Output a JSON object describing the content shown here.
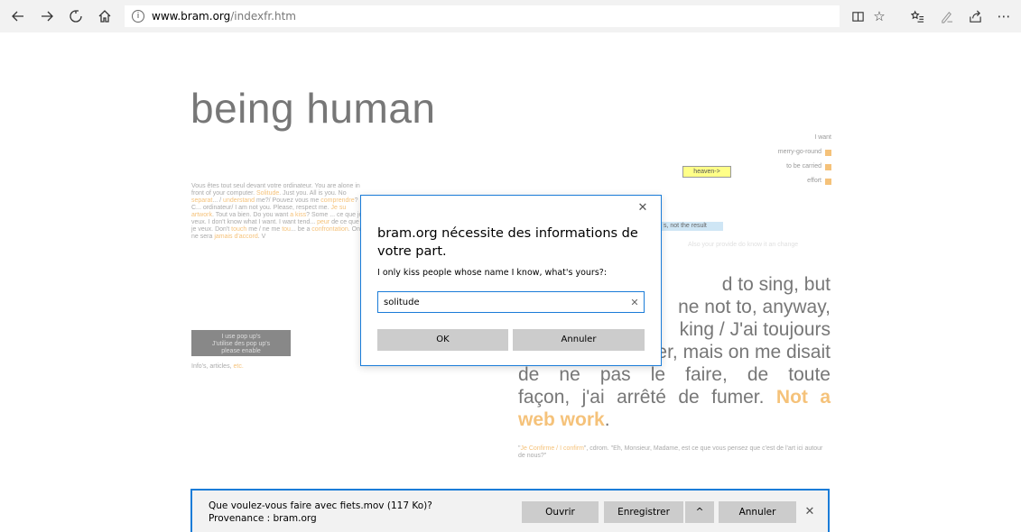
{
  "browser": {
    "url_domain": "www.bram.org",
    "url_path": "/indexfr.htm",
    "info_icon_text": "i",
    "icons": [
      "back-icon",
      "forward-icon",
      "refresh-icon",
      "home-icon",
      "reading-view-icon",
      "favorite-star-icon",
      "favorites-hub-icon",
      "web-note-icon",
      "share-icon",
      "more-icon"
    ]
  },
  "page": {
    "title": "being human",
    "menu_right": {
      "item1": "I want",
      "item2": "merry-go-round",
      "item3": "to be carried",
      "item4": "effort"
    },
    "heaven_label": "heaven->",
    "intro": {
      "p1": "Vous êtes tout seul devant votre ordinateur. You are alone in front of your computer.",
      "link1": "Solitude",
      "p2": ". Just you. All is you. No",
      "link2": "separat",
      "p3": "... /",
      "link3": "understand",
      "p4": "me?/ Pouvez vous me",
      "link4": "comprendre",
      "p5": "? C... ordinateur/ I am not you. Please, respect me.",
      "link5": "Je su",
      "link6": "artwork",
      "p6": ". Tout va bien. Do you want",
      "link7": "a kiss",
      "p7": "? Some ... ce que je veux. I don't know what I want. I want tend...",
      "link8": "peur",
      "p8": "de ce que je veux. Don't",
      "link9": "touch",
      "p9": "me / ne me",
      "link10": "tou",
      "p10": "... be a",
      "link11": "confrontation",
      "p11": ". On ne sera",
      "link12": "jamais d'accord",
      "p12": ". V"
    },
    "highlight_text": "s, not the result",
    "faint_note": "Also your provide do know it an change",
    "popup_button": {
      "line1": "I use pop up's",
      "line2": "J'utilise des pop up's",
      "line3": "please enable"
    },
    "infos": {
      "text": "Info's, articles,",
      "link": "etc."
    },
    "big_text": {
      "l1_visible": "d to sing, but",
      "l2_visible": "ne not to, anyway,",
      "l3_visible": "king / J'ai toujours",
      "l4_visible": "voulu chanter, mais on me disait",
      "l5": "de ne pas le faire, de toute",
      "l6": "façon, j'ai arrêté de fumer.",
      "link": "Not a web work",
      "end": "."
    },
    "foot_note": {
      "quote_open": "\"",
      "link": "Je Confirme / I confirm",
      "rest": "\", cdrom. \"Eh, Monsieur, Madame, est ce que vous pensez que c'est de l'art ici autour de nous?\""
    }
  },
  "dialog": {
    "title": "bram.org nécessite des informations de votre part.",
    "message": "I only kiss people whose name I know, what's yours?:",
    "input_value": "solitude",
    "ok_label": "OK",
    "cancel_label": "Annuler",
    "close_glyph": "✕",
    "clear_glyph": "✕"
  },
  "download_bar": {
    "question": "Que voulez-vous faire avec fiets.mov (117 Ko)?",
    "source": "Provenance : bram.org",
    "open_label": "Ouvrir",
    "save_label": "Enregistrer",
    "chevron_glyph": "^",
    "cancel_label": "Annuler",
    "close_glyph": "✕"
  }
}
